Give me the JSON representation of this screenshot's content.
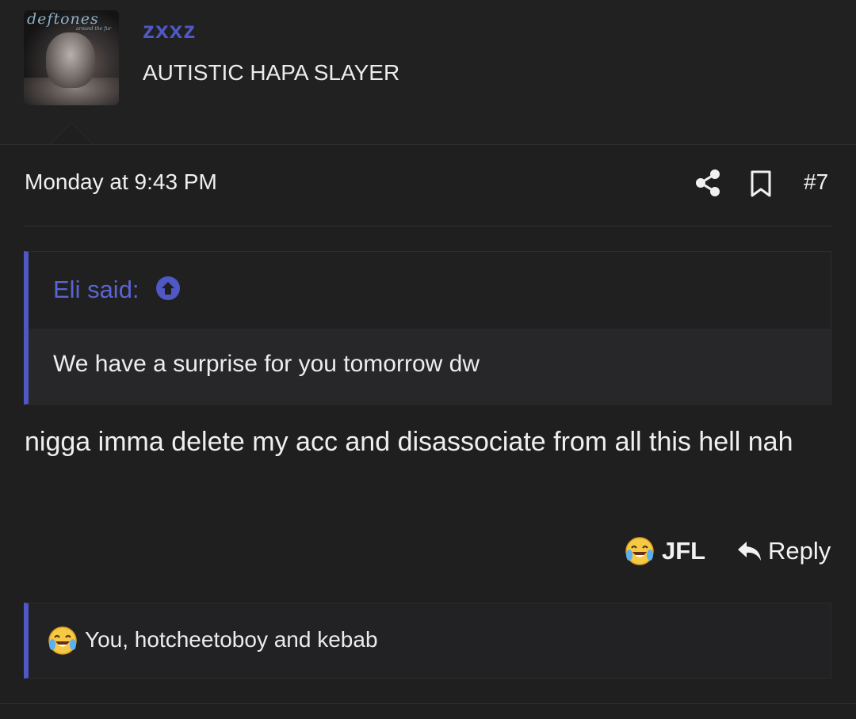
{
  "user": {
    "avatar_text": "deftones",
    "avatar_subtext": "around the fur",
    "username": "zxxz",
    "title": "AUTISTIC HAPA SLAYER"
  },
  "post": {
    "date": "Monday at 9:43 PM",
    "number": "#7",
    "quote": {
      "author": "Eli said:",
      "text": "We have a surprise for you tomorrow dw"
    },
    "message": "nigga imma delete my acc and disassociate from all this hell nah",
    "actions": {
      "react_label": "JFL",
      "reply_label": "Reply"
    },
    "reactions_summary": "You, hotcheetoboy and kebab"
  },
  "icons": {
    "share": "share-icon",
    "bookmark": "bookmark-icon",
    "quote_jump": "arrow-up-circle-icon",
    "react": "crying-laughing-emoji-icon",
    "reply": "reply-arrow-icon"
  },
  "colors": {
    "accent": "#4f58c4",
    "background": "#1f1f20",
    "text": "#ececec"
  }
}
